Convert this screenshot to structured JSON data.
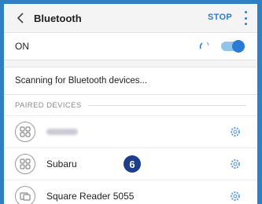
{
  "header": {
    "title": "Bluetooth",
    "stop_label": "STOP",
    "back_icon": "chevron-left-icon",
    "more_icon": "more-vertical-icon"
  },
  "bluetooth": {
    "status_label": "ON",
    "enabled": true
  },
  "scanning": {
    "text": "Scanning for Bluetooth devices..."
  },
  "paired": {
    "section_title": "PAIRED DEVICES",
    "devices": [
      {
        "name": "",
        "icon": "grid-device-icon",
        "settings_icon": "gear-icon"
      },
      {
        "name": "Subaru",
        "icon": "grid-device-icon",
        "settings_icon": "gear-icon",
        "callout": "6"
      },
      {
        "name": "Square Reader 5055",
        "icon": "card-reader-icon",
        "settings_icon": "gear-icon"
      }
    ]
  },
  "colors": {
    "accent": "#2a7bd8",
    "frame": "#2f7fc3",
    "callout": "#1d3e8a"
  }
}
